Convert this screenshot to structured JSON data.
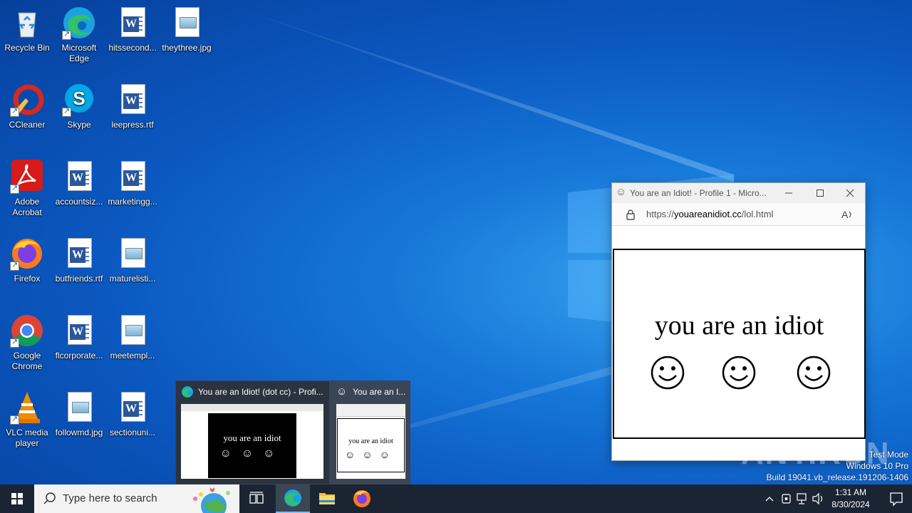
{
  "desktop": {
    "icons": [
      {
        "label": "Recycle Bin"
      },
      {
        "label": "Microsoft Edge"
      },
      {
        "label": "hitssecond..."
      },
      {
        "label": "theythree.jpg"
      },
      {
        "label": "CCleaner"
      },
      {
        "label": "Skype"
      },
      {
        "label": "leepress.rtf"
      },
      {
        "label": "Adobe Acrobat"
      },
      {
        "label": "accountsiz..."
      },
      {
        "label": "marketingg..."
      },
      {
        "label": "Firefox"
      },
      {
        "label": "butfriends.rtf"
      },
      {
        "label": "maturelisti..."
      },
      {
        "label": "Google Chrome"
      },
      {
        "label": "flcorporate..."
      },
      {
        "label": "meetempl..."
      },
      {
        "label": "VLC media player"
      },
      {
        "label": "followmd.jpg"
      },
      {
        "label": "sectionuni..."
      }
    ]
  },
  "browser_window": {
    "title": "You are an Idiot! - Profile 1 - Micro...",
    "url_prefix": "https://",
    "url_host": "youareanidiot.cc",
    "url_path": "/lol.html",
    "content_text": "you are an idiot",
    "smiley": "☺"
  },
  "thumbnails": [
    {
      "title": "You are an Idiot! (dot cc) - Profi...",
      "preview_text": "you are an idiot"
    },
    {
      "title": "You are an I...",
      "preview_text": "you are an idiot"
    }
  ],
  "taskbar": {
    "search_placeholder": "Type here to search",
    "time": "1:31 AM",
    "date": "8/30/2024"
  },
  "watermark": {
    "line1": "Test Mode",
    "line2": "Windows 10 Pro",
    "line3": "Build 19041.vb_release.191206-1406",
    "brand": "ANY.RUN"
  },
  "colors": {
    "accent": "#0078d7",
    "taskbar": "#1b2433",
    "word_blue": "#2b579a"
  }
}
